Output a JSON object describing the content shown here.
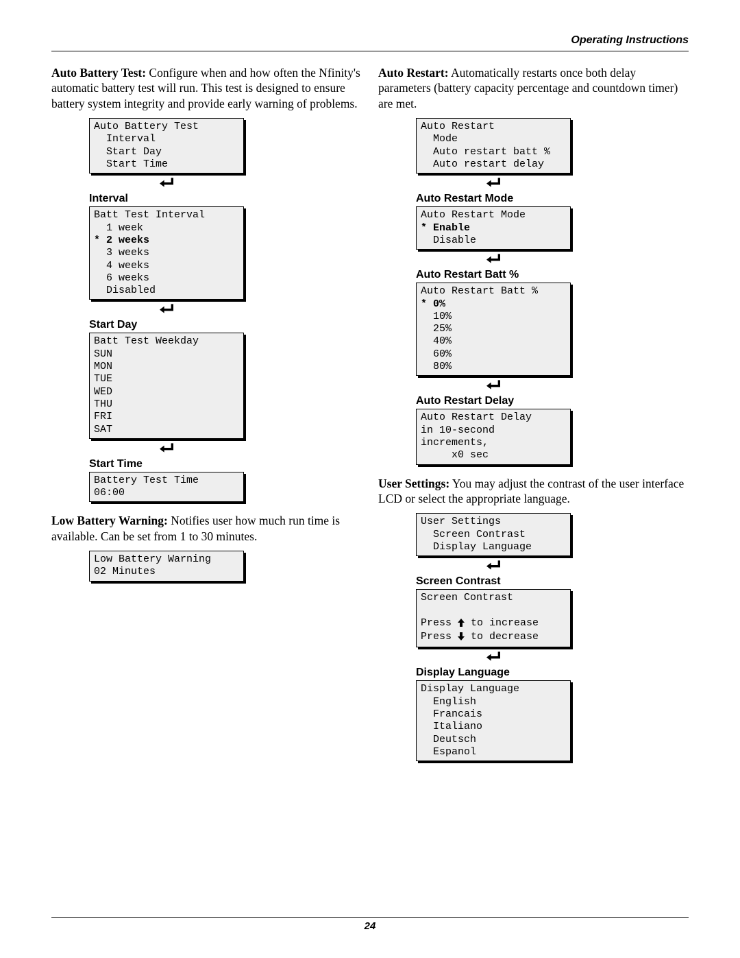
{
  "header": {
    "title": "Operating Instructions"
  },
  "left": {
    "p1_lead": "Auto Battery Test:",
    "p1_rest": " Configure when and how often the Nfinity's automatic battery test will run. This test is designed to ensure battery system integrity and provide early warning of problems.",
    "lcd1": "Auto Battery Test\n  Interval\n  Start Day\n  Start Time",
    "h_interval": "Interval",
    "lcd2_pre": "Batt Test Interval\n  1 week\n",
    "lcd2_bold": "* 2 weeks",
    "lcd2_post": "\n  3 weeks\n  4 weeks\n  6 weeks\n  Disabled",
    "h_startday": "Start Day",
    "lcd3": "Batt Test Weekday\nSUN\nMON\nTUE\nWED\nTHU\nFRI\nSAT",
    "h_starttime": "Start Time",
    "lcd4": "Battery Test Time\n06:00",
    "p2_lead": "Low Battery Warning:",
    "p2_rest": " Notifies user how much run time is available. Can be set from 1 to 30 minutes.",
    "lcd5": "Low Battery Warning\n02 Minutes"
  },
  "right": {
    "p1_lead": "Auto Restart:",
    "p1_rest": " Automatically restarts once both delay parameters (battery capacity percentage and countdown timer) are met.",
    "lcd1": "Auto Restart\n  Mode\n  Auto restart batt %\n  Auto restart delay",
    "h_mode": "Auto Restart Mode",
    "lcd2_pre": "Auto Restart Mode\n",
    "lcd2_bold": "* Enable",
    "lcd2_post": "\n  Disable",
    "h_batt": "Auto Restart Batt %",
    "lcd3_pre": "Auto Restart Batt %\n",
    "lcd3_bold": "* 0%",
    "lcd3_post": "\n  10%\n  25%\n  40%\n  60%\n  80%",
    "h_delay": "Auto Restart Delay",
    "lcd4": "Auto Restart Delay\nin 10-second\nincrements,\n     x0 sec",
    "p2_lead": "User Settings:",
    "p2_rest": " You may adjust the contrast of the user interface LCD or select the appropriate language.",
    "lcd5": "User Settings\n  Screen Contrast\n  Display Language",
    "h_contrast": "Screen Contrast",
    "lcd6_l1": "Screen Contrast",
    "lcd6_l2a": "Press ",
    "lcd6_l2b": " to increase",
    "lcd6_l3a": "Press ",
    "lcd6_l3b": " to decrease",
    "h_lang": "Display Language",
    "lcd7": "Display Language\n  English\n  Francais\n  Italiano\n  Deutsch\n  Espanol"
  },
  "footer": {
    "page": "24"
  }
}
